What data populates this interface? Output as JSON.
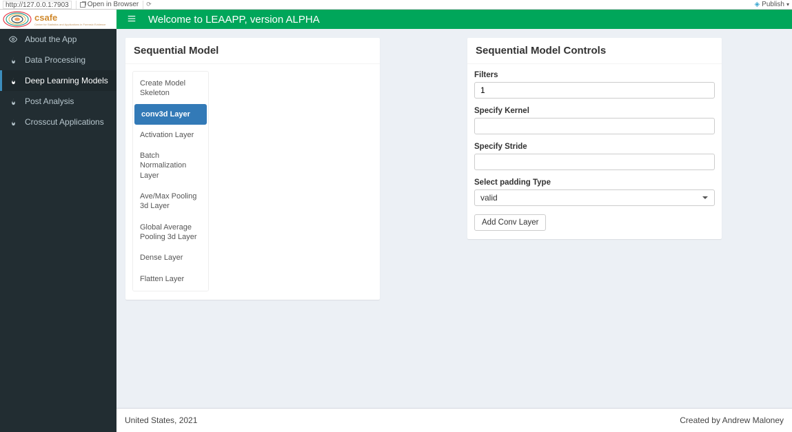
{
  "browser": {
    "url": "http://127.0.0.1:7903",
    "open_in_browser": "Open in Browser",
    "publish": "Publish"
  },
  "header": {
    "title": "Welcome to LEAAPP, version ALPHA"
  },
  "sidebar": {
    "items": [
      {
        "label": "About the App",
        "icon_name": "eye-icon"
      },
      {
        "label": "Data Processing",
        "icon_name": "flame-icon"
      },
      {
        "label": "Deep Learning Models",
        "icon_name": "flame-icon"
      },
      {
        "label": "Post Analysis",
        "icon_name": "flame-icon"
      },
      {
        "label": "Crosscut Applications",
        "icon_name": "flame-icon"
      }
    ],
    "active_index": 2
  },
  "left_panel": {
    "title": "Sequential Model",
    "tabs": [
      "Create Model Skeleton",
      "conv3d Layer",
      "Activation Layer",
      "Batch Normalization Layer",
      "Ave/Max Pooling 3d Layer",
      "Global Average Pooling 3d Layer",
      "Dense Layer",
      "Flatten Layer"
    ],
    "active_tab_index": 1
  },
  "right_panel": {
    "title": "Sequential Model Controls",
    "filters_label": "Filters",
    "filters_value": "1",
    "kernel_label": "Specify Kernel",
    "kernel_value": "",
    "stride_label": "Specify Stride",
    "stride_value": "",
    "padding_label": "Select padding Type",
    "padding_value": "valid",
    "add_button": "Add Conv Layer"
  },
  "footer": {
    "left": "United States, 2021",
    "right": "Created by Andrew Maloney"
  }
}
